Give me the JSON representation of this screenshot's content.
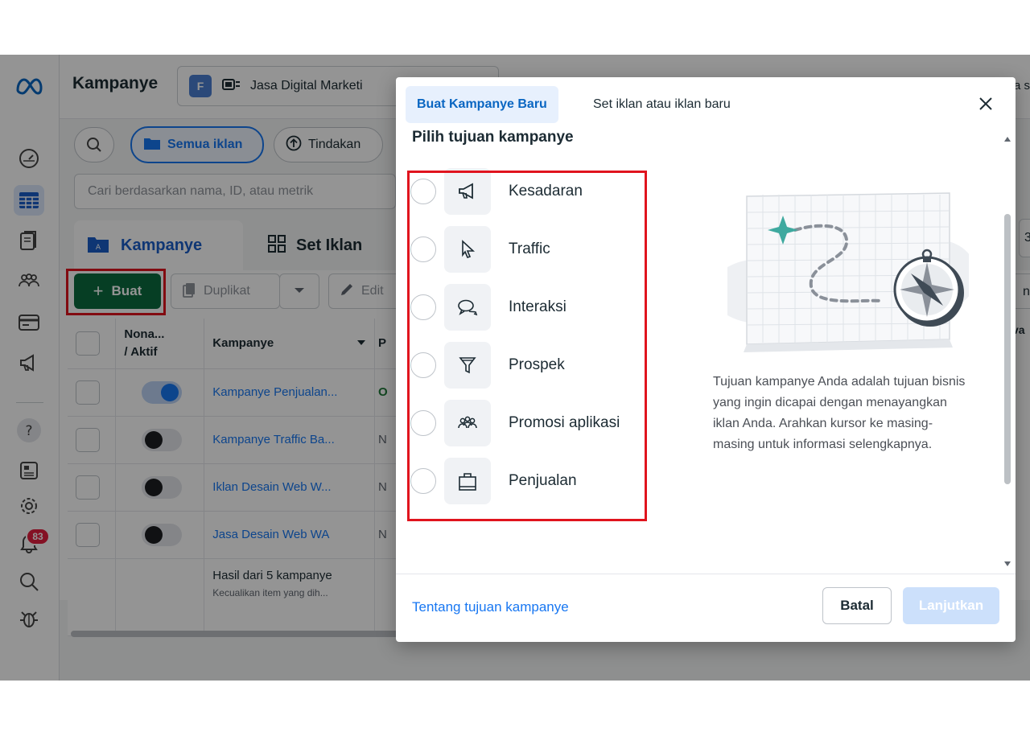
{
  "topbar": {
    "title": "Kampanye",
    "account_initial": "F",
    "account_name": "Jasa Digital Marketi",
    "right_partial": "a s"
  },
  "toolbar": {
    "filter_all": "Semua iklan",
    "actions": "Tindakan"
  },
  "search": {
    "placeholder": "Cari berdasarkan nama, ID, atau metrik"
  },
  "level_tabs": {
    "campaigns": "Kampanye",
    "ad_sets": "Set Iklan",
    "partial": "3"
  },
  "actions_bar": {
    "create": "Buat",
    "duplicate": "Duplikat",
    "edit": "Edit",
    "partial": "n"
  },
  "table": {
    "col_toggle": "Nona... / Aktif",
    "col_toggle_line1": "Nona...",
    "col_toggle_line2": "/ Aktif",
    "col_campaign": "Kampanye",
    "col_partial": "P",
    "col_right_partial": "va",
    "rows": [
      {
        "name": "Kampanye Penjualan...",
        "status": "O",
        "active": true
      },
      {
        "name": "Kampanye Traffic Ba...",
        "status": "N",
        "active": false
      },
      {
        "name": "Iklan Desain Web W...",
        "status": "N",
        "active": false
      },
      {
        "name": "Jasa Desain Web WA",
        "status": "N",
        "active": false
      }
    ],
    "summary_title": "Hasil dari 5 kampanye",
    "summary_sub": "Kecualikan item yang dih..."
  },
  "rail": {
    "notifications_count": "83"
  },
  "modal": {
    "tab_new_campaign": "Buat Kampanye Baru",
    "tab_set_ad": "Set iklan atau iklan baru",
    "section_title": "Pilih tujuan kampanye",
    "objectives": [
      {
        "label": "Kesadaran",
        "icon": "megaphone-icon"
      },
      {
        "label": "Traffic",
        "icon": "cursor-icon"
      },
      {
        "label": "Interaksi",
        "icon": "chat-bubbles-icon"
      },
      {
        "label": "Prospek",
        "icon": "filter-icon"
      },
      {
        "label": "Promosi aplikasi",
        "icon": "people-icon"
      },
      {
        "label": "Penjualan",
        "icon": "shopping-bag-icon"
      }
    ],
    "description": "Tujuan kampanye Anda adalah tujuan bisnis yang ingin dicapai dengan menayangkan iklan Anda. Arahkan kursor ke masing-masing untuk informasi selengkapnya.",
    "footer_link": "Tentang tujuan kampanye",
    "cancel": "Batal",
    "continue": "Lanjutkan"
  },
  "colors": {
    "accent": "#1877f2",
    "create_button": "#0b6b3e",
    "highlight": "#e0141e",
    "badge": "#e41e3f"
  }
}
